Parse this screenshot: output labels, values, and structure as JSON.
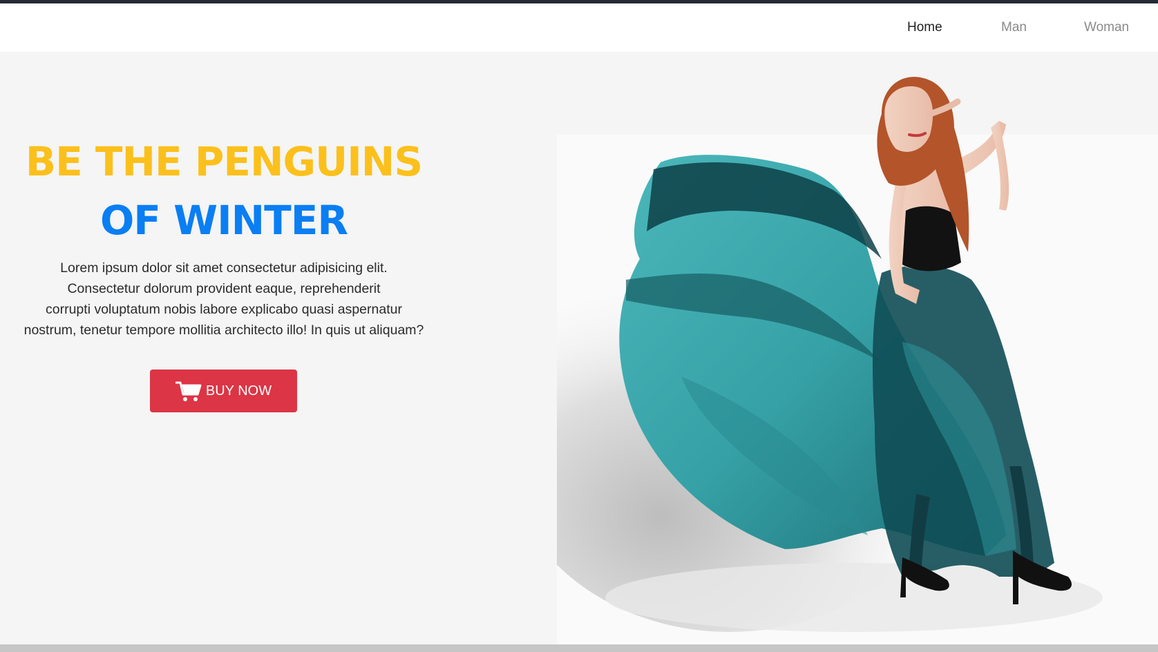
{
  "nav": {
    "items": [
      {
        "label": "Home",
        "active": true
      },
      {
        "label": "Man",
        "active": false
      },
      {
        "label": "Woman",
        "active": false
      }
    ]
  },
  "hero": {
    "headline_line1": "BE THE PENGUINS",
    "headline_line2": "OF WINTER",
    "body_lines": [
      "Lorem ipsum dolor sit amet consectetur adipisicing elit.",
      "Consectetur dolorum provident eaque, reprehenderit",
      "corrupti voluptatum nobis labore explicabo quasi aspernatur",
      "nostrum, tenetur tempore mollitia architecto illo! In quis ut aliquam?"
    ],
    "buy_button_label": "BUY NOW",
    "buy_button_icon": "shopping-cart-icon",
    "image_subject": "model-in-teal-dress"
  },
  "colors": {
    "top_strip": "#262a35",
    "hero_background": "#f4f5f4",
    "headline_primary": "#fcc01c",
    "headline_secondary": "#0a7ef3",
    "button_red": "#dc3545",
    "dress_teal": "#3aa9ad",
    "bottom_strip": "#c6c6c6"
  }
}
